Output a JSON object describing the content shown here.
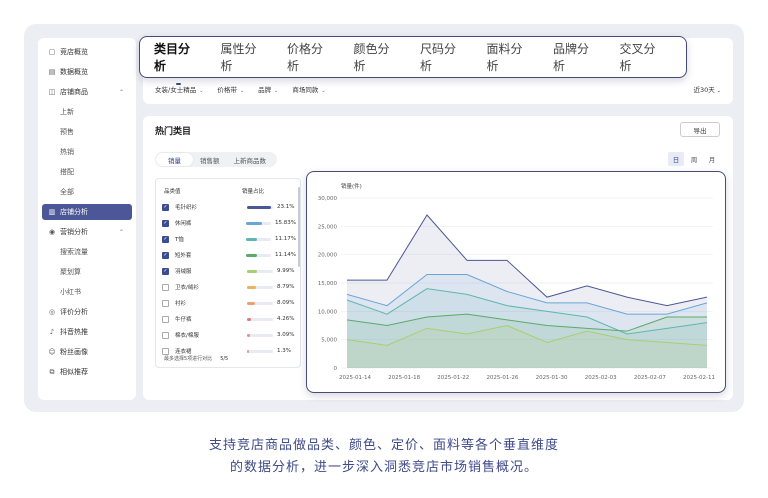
{
  "sidebar": {
    "items": [
      {
        "label": "竞店概览",
        "icon": "store-icon",
        "level": 1
      },
      {
        "label": "数据概览",
        "icon": "dashboard-icon",
        "level": 1
      },
      {
        "label": "店铺商品",
        "icon": "bag-icon",
        "level": 1,
        "expanded": true
      },
      {
        "label": "上新",
        "level": 2
      },
      {
        "label": "预售",
        "level": 2
      },
      {
        "label": "热销",
        "level": 2
      },
      {
        "label": "搭配",
        "level": 2
      },
      {
        "label": "全部",
        "level": 2
      },
      {
        "label": "店铺分析",
        "icon": "analysis-icon",
        "level": 1,
        "active": true
      },
      {
        "label": "营销分析",
        "icon": "marketing-icon",
        "level": 1,
        "expanded": true
      },
      {
        "label": "搜索流量",
        "level": 2
      },
      {
        "label": "聚划算",
        "level": 2
      },
      {
        "label": "小红书",
        "level": 2
      },
      {
        "label": "评价分析",
        "icon": "comment-icon",
        "level": 1
      },
      {
        "label": "抖音热推",
        "icon": "douyin-icon",
        "level": 1
      },
      {
        "label": "粉丝画像",
        "icon": "fans-icon",
        "level": 1
      },
      {
        "label": "相似推荐",
        "icon": "similar-icon",
        "level": 1
      }
    ]
  },
  "tabs": [
    "类目分析",
    "属性分析",
    "价格分析",
    "颜色分析",
    "尺码分析",
    "面料分析",
    "品牌分析",
    "交叉分析"
  ],
  "filters": [
    "女装/女士精品",
    "价格带",
    "品牌",
    "商场同款"
  ],
  "range": "近30天",
  "panel": {
    "title": "热门类目",
    "export": "导出",
    "metric_tabs": [
      "销量",
      "销售额",
      "上新商品数"
    ],
    "period": [
      "日",
      "周",
      "月"
    ]
  },
  "categories": {
    "header_name": "品类值",
    "header_share": "销量占比",
    "rows": [
      {
        "name": "毛针织衫",
        "pct": "23.1%",
        "value": 23.1,
        "checked": true,
        "color": "#4b5796"
      },
      {
        "name": "休闲裤",
        "pct": "15.83%",
        "value": 15.83,
        "checked": true,
        "color": "#6aa6d8"
      },
      {
        "name": "T恤",
        "pct": "11.17%",
        "value": 11.17,
        "checked": true,
        "color": "#5fb6b0"
      },
      {
        "name": "短外套",
        "pct": "11.14%",
        "value": 11.14,
        "checked": true,
        "color": "#5aaa6a"
      },
      {
        "name": "羽绒服",
        "pct": "9.99%",
        "value": 9.99,
        "checked": true,
        "color": "#a8cf6e"
      },
      {
        "name": "卫衣/绒衫",
        "pct": "8.79%",
        "value": 8.79,
        "checked": false,
        "color": "#f0b060"
      },
      {
        "name": "衬衫",
        "pct": "8.09%",
        "value": 8.09,
        "checked": false,
        "color": "#f0a070"
      },
      {
        "name": "牛仔裤",
        "pct": "4.26%",
        "value": 4.26,
        "checked": false,
        "color": "#e47a7a"
      },
      {
        "name": "棉衣/棉服",
        "pct": "3.09%",
        "value": 3.09,
        "checked": false,
        "color": "#e88a9a"
      },
      {
        "name": "连衣裙",
        "pct": "1.3%",
        "value": 1.3,
        "checked": false,
        "color": "#d89ab8"
      }
    ],
    "footer_note": "最多选择5项进行对比",
    "footer_count": "5/5"
  },
  "chart_data": {
    "type": "area",
    "ylabel": "销量(件)",
    "ylim": [
      0,
      30000
    ],
    "yticks": [
      "30,000",
      "25,000",
      "20,000",
      "15,000",
      "10,000",
      "5,000",
      "0"
    ],
    "ytick_values": [
      30000,
      25000,
      20000,
      15000,
      10000,
      5000,
      0
    ],
    "x": [
      "2025-01-14",
      "2025-01-18",
      "2025-01-22",
      "2025-01-26",
      "2025-01-30",
      "2025-02-03",
      "2025-02-07",
      "2025-02-11"
    ],
    "series": [
      {
        "name": "毛针织衫",
        "color": "#4b5796",
        "values": [
          15500,
          15500,
          27000,
          19000,
          19000,
          12500,
          14500,
          12500,
          11000,
          12500
        ]
      },
      {
        "name": "休闲裤",
        "color": "#6aa6d8",
        "values": [
          13000,
          11000,
          16500,
          16500,
          13500,
          11500,
          11500,
          9500,
          9500,
          11500
        ]
      },
      {
        "name": "T恤",
        "color": "#5fb6b0",
        "values": [
          12000,
          9500,
          14000,
          13000,
          11000,
          10000,
          9000,
          6000,
          7000,
          8000
        ]
      },
      {
        "name": "短外套",
        "color": "#5aaa6a",
        "values": [
          8500,
          7500,
          9000,
          9500,
          8500,
          7500,
          7000,
          6500,
          9000,
          9000
        ]
      },
      {
        "name": "羽绒服",
        "color": "#a8cf6e",
        "values": [
          5000,
          4000,
          7000,
          6000,
          7500,
          4500,
          6500,
          5000,
          4500,
          4000
        ]
      }
    ]
  },
  "caption": {
    "line1": "支持竞店商品做品类、颜色、定价、面料等各个垂直维度",
    "line2": "的数据分析，进一步深入洞悉竞店市场销售概况。"
  }
}
